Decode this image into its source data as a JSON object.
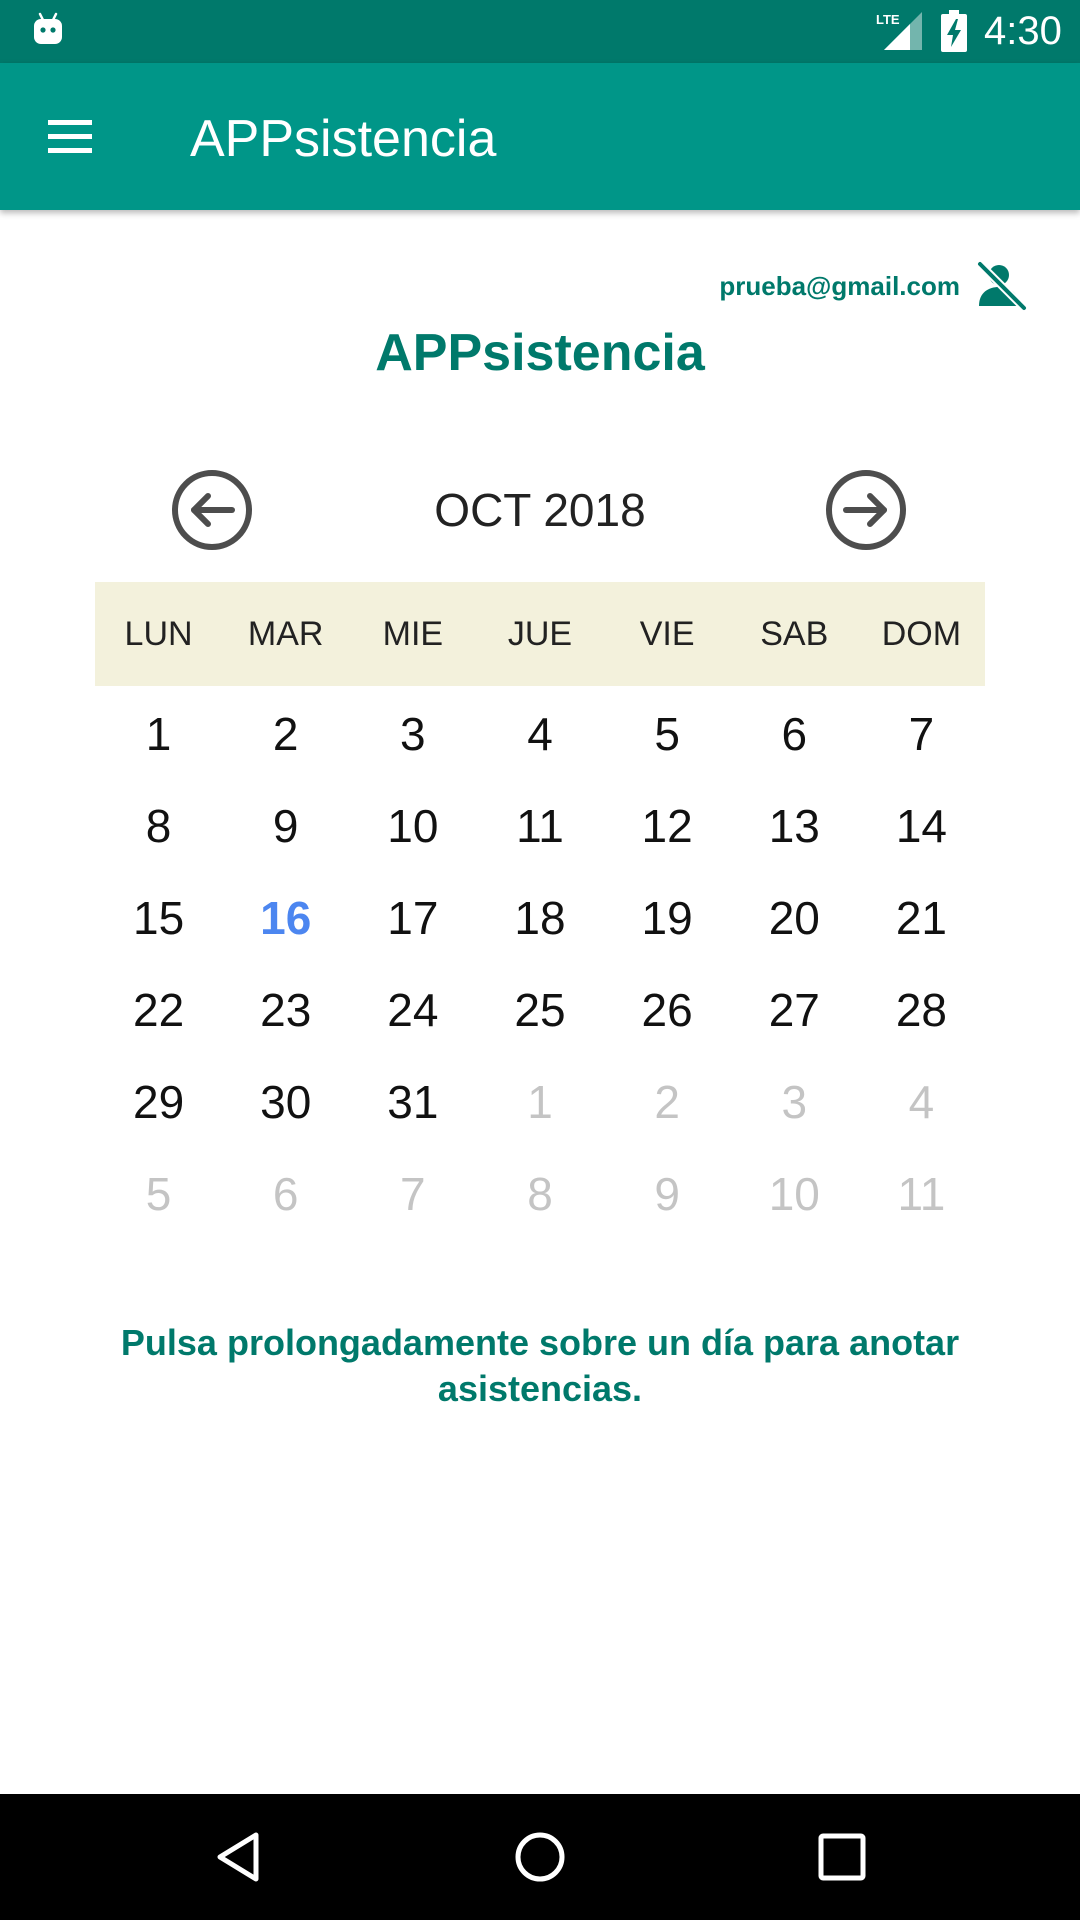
{
  "status_bar": {
    "time": "4:30",
    "network": "LTE",
    "icons": [
      "android-robot-icon",
      "lte-signal-icon",
      "battery-charging-icon"
    ]
  },
  "app_bar": {
    "title": "APPsistencia",
    "menu_icon": "hamburger-menu-icon"
  },
  "user": {
    "email": "prueba@gmail.com",
    "icon": "user-off-icon"
  },
  "main_title": "APPsistencia",
  "calendar": {
    "month_label": "OCT 2018",
    "prev_icon": "arrow-left-circle-icon",
    "next_icon": "arrow-right-circle-icon",
    "weekdays": [
      "LUN",
      "MAR",
      "MIE",
      "JUE",
      "VIE",
      "SAB",
      "DOM"
    ],
    "days": [
      {
        "label": "1",
        "kind": "current"
      },
      {
        "label": "2",
        "kind": "current"
      },
      {
        "label": "3",
        "kind": "current"
      },
      {
        "label": "4",
        "kind": "current"
      },
      {
        "label": "5",
        "kind": "current"
      },
      {
        "label": "6",
        "kind": "current"
      },
      {
        "label": "7",
        "kind": "current"
      },
      {
        "label": "8",
        "kind": "current"
      },
      {
        "label": "9",
        "kind": "current"
      },
      {
        "label": "10",
        "kind": "current"
      },
      {
        "label": "11",
        "kind": "current"
      },
      {
        "label": "12",
        "kind": "current"
      },
      {
        "label": "13",
        "kind": "current"
      },
      {
        "label": "14",
        "kind": "current"
      },
      {
        "label": "15",
        "kind": "current"
      },
      {
        "label": "16",
        "kind": "today"
      },
      {
        "label": "17",
        "kind": "current"
      },
      {
        "label": "18",
        "kind": "current"
      },
      {
        "label": "19",
        "kind": "current"
      },
      {
        "label": "20",
        "kind": "current"
      },
      {
        "label": "21",
        "kind": "current"
      },
      {
        "label": "22",
        "kind": "current"
      },
      {
        "label": "23",
        "kind": "current"
      },
      {
        "label": "24",
        "kind": "current"
      },
      {
        "label": "25",
        "kind": "current"
      },
      {
        "label": "26",
        "kind": "current"
      },
      {
        "label": "27",
        "kind": "current"
      },
      {
        "label": "28",
        "kind": "current"
      },
      {
        "label": "29",
        "kind": "current"
      },
      {
        "label": "30",
        "kind": "current"
      },
      {
        "label": "31",
        "kind": "current"
      },
      {
        "label": "1",
        "kind": "other"
      },
      {
        "label": "2",
        "kind": "other"
      },
      {
        "label": "3",
        "kind": "other"
      },
      {
        "label": "4",
        "kind": "other"
      },
      {
        "label": "5",
        "kind": "other"
      },
      {
        "label": "6",
        "kind": "other"
      },
      {
        "label": "7",
        "kind": "other"
      },
      {
        "label": "8",
        "kind": "other"
      },
      {
        "label": "9",
        "kind": "other"
      },
      {
        "label": "10",
        "kind": "other"
      },
      {
        "label": "11",
        "kind": "other"
      }
    ]
  },
  "hint": "Pulsa prolongadamente sobre un día para anotar asistencias.",
  "nav_bar": {
    "icons": [
      "back-triangle-icon",
      "home-circle-icon",
      "recents-square-icon"
    ]
  },
  "colors": {
    "primary": "#009688",
    "primary_dark": "#00796b",
    "weekday_band": "#f3f1dc",
    "today": "#4c86f0",
    "other_month": "#c4c4c4"
  }
}
